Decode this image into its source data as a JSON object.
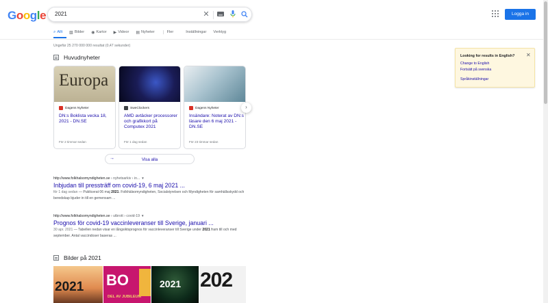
{
  "logo": {
    "letters": [
      "G",
      "o",
      "o",
      "g",
      "l",
      "e"
    ]
  },
  "search": {
    "query": "2021"
  },
  "header": {
    "login_label": "Logga in"
  },
  "tabs": [
    {
      "label": "Allt",
      "icon": "search-icon",
      "active": true
    },
    {
      "label": "Bilder",
      "icon": "image-icon"
    },
    {
      "label": "Kartor",
      "icon": "map-pin-icon"
    },
    {
      "label": "Videor",
      "icon": "video-icon"
    },
    {
      "label": "Nyheter",
      "icon": "newspaper-icon"
    },
    {
      "label": "Fler",
      "icon": "more-vert-icon"
    },
    {
      "label": "Inställningar"
    },
    {
      "label": "Verktyg"
    }
  ],
  "stats": "Ungefär 25 270 000 000 resultat (0,47 sekunder)",
  "news": {
    "heading": "Huvudnyheter",
    "cards": [
      {
        "source": "Dagens Nyheter",
        "title": "DN:s Boklista vecka 18, 2021 - DN.SE",
        "age": "För 2 timmar sedan",
        "thumb_color": "#c9c0a6"
      },
      {
        "source": "SweClockers",
        "title": "AMD avtäcker processorer och grafikkort på Computex 2021",
        "age": "För 1 dag sedan",
        "thumb_color": "#14163a"
      },
      {
        "source": "Dagens Nyheter",
        "title": "Insändare: Noterat av DN:s läsare den 6 maj 2021 - DN.SE",
        "age": "För 23 timmar sedan",
        "thumb_color": "#7fa6b8"
      }
    ],
    "show_all": "Visa alla"
  },
  "results": [
    {
      "url": "http://www.folkhalsomyndigheten.se",
      "crumb": " › nyhetsarkiv › in...",
      "title": "Inbjudan till pressträff om covid-19, 6 maj 2021 ...",
      "date": "för 1 dag sedan",
      "snip_a": " — Publicerat 06 maj ",
      "snip_bold": "2021",
      "snip_b": ". Folkhälsomyndigheten, Socialstyrelsen och Myndigheten för samhällsskydd och beredskap bjuder in till en gemensam ..."
    },
    {
      "url": "http://www.folkhalsomyndigheten.se",
      "crumb": " › utbrott › covid-19",
      "title": "Prognos för covid-19 vaccinleveranser till Sverige, januari ...",
      "date": "30 apr. 2021",
      "snip_a": " — Tabellen nedan visar en långsiktsprognos för vaccinleveranser till Sverige under ",
      "snip_bold": "2021",
      "snip_b": " fram till och med september. Antal vaccindoser baseras ..."
    }
  ],
  "images": {
    "heading": "Bilder på 2021",
    "tiles": [
      {
        "text": "2021",
        "bg": "#e9a86b",
        "fg": "#1b1b1b"
      },
      {
        "text": "BO",
        "sub": "DEL AV JUBILEUM",
        "bg": "#c7166e",
        "fg": "#ffffff"
      },
      {
        "text": "2021",
        "bg": "#0d2a1a",
        "fg": "#ffffff"
      },
      {
        "text": "202",
        "bg": "#f2f2f2",
        "fg": "#1b1b1b"
      }
    ]
  },
  "lang_box": {
    "question": "Looking for results in English?",
    "change": "Change to English",
    "keep": "Fortsätt på svenska",
    "settings": "Språkinställningar"
  },
  "colors": {
    "accent": "#1a73e8",
    "link": "#1a0dab"
  }
}
